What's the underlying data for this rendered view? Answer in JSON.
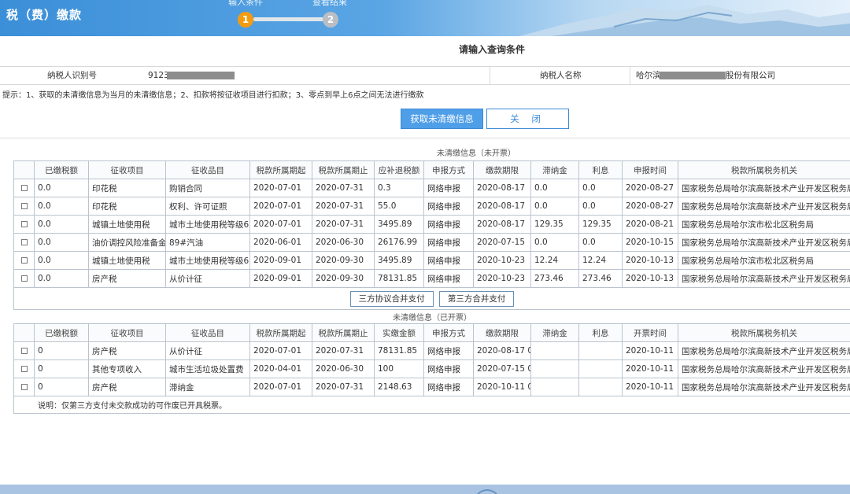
{
  "header": {
    "title": "税（费）缴款",
    "steps": [
      {
        "number": "1",
        "label": "输入条件",
        "color": "#f39c12"
      },
      {
        "number": "2",
        "label": "查看结果",
        "color": "#b9bec4"
      }
    ]
  },
  "query": {
    "title": "请输入查询条件",
    "taxpayer_id_label": "纳税人识别号",
    "taxpayer_id_value": "9123",
    "taxpayer_name_label": "纳税人名称",
    "taxpayer_name_prefix": "哈尔滨",
    "taxpayer_name_suffix": "股份有限公司"
  },
  "tip": "提示：1、获取的未清缴信息为当月的未清缴信息；2、扣款将按征收项目进行扣款；3、零点到早上6点之间无法进行缴款",
  "buttons": {
    "fetch": "获取未清缴信息",
    "close": "关 闭",
    "tripartite": "三方协议合并支付",
    "thirdparty": "第三方合并支付"
  },
  "table1": {
    "caption": "未清缴信息（未开票）",
    "headers": [
      "",
      "已缴税额",
      "征收项目",
      "征收品目",
      "税款所属期起",
      "税款所属期止",
      "应补退税额",
      "申报方式",
      "缴款期限",
      "滞纳金",
      "利息",
      "申报时间",
      "税款所属税务机关"
    ],
    "rows": [
      [
        "0.0",
        "印花税",
        "购销合同",
        "2020-07-01",
        "2020-07-31",
        "0.3",
        "网络申报",
        "2020-08-17",
        "0.0",
        "0.0",
        "2020-08-27",
        "国家税务总局哈尔滨高新技术产业开发区税务局"
      ],
      [
        "0.0",
        "印花税",
        "权利、许可证照",
        "2020-07-01",
        "2020-07-31",
        "55.0",
        "网络申报",
        "2020-08-17",
        "0.0",
        "0.0",
        "2020-08-27",
        "国家税务总局哈尔滨高新技术产业开发区税务局"
      ],
      [
        "0.0",
        "城镇土地使用税",
        "城市土地使用税等级6",
        "2020-07-01",
        "2020-07-31",
        "3495.89",
        "网络申报",
        "2020-08-17",
        "129.35",
        "129.35",
        "2020-08-21",
        "国家税务总局哈尔滨市松北区税务局"
      ],
      [
        "0.0",
        "油价调控风险准备金",
        "89#汽油",
        "2020-06-01",
        "2020-06-30",
        "26176.99",
        "网络申报",
        "2020-07-15",
        "0.0",
        "0.0",
        "2020-10-15",
        "国家税务总局哈尔滨高新技术产业开发区税务局"
      ],
      [
        "0.0",
        "城镇土地使用税",
        "城市土地使用税等级6",
        "2020-09-01",
        "2020-09-30",
        "3495.89",
        "网络申报",
        "2020-10-23",
        "12.24",
        "12.24",
        "2020-10-13",
        "国家税务总局哈尔滨市松北区税务局"
      ],
      [
        "0.0",
        "房产税",
        "从价计征",
        "2020-09-01",
        "2020-09-30",
        "78131.85",
        "网络申报",
        "2020-10-23",
        "273.46",
        "273.46",
        "2020-10-13",
        "国家税务总局哈尔滨高新技术产业开发区税务局"
      ]
    ]
  },
  "table2": {
    "caption": "未清缴信息（已开票）",
    "headers": [
      "",
      "已缴税额",
      "征收项目",
      "征收品目",
      "税款所属期起",
      "税款所属期止",
      "实缴金额",
      "申报方式",
      "缴款期限",
      "滞纳金",
      "利息",
      "开票时间",
      "税款所属税务机关"
    ],
    "rows": [
      [
        "0",
        "房产税",
        "从价计征",
        "2020-07-01",
        "2020-07-31",
        "78131.85",
        "网络申报",
        "2020-08-17 0",
        "",
        "",
        "2020-10-11",
        "国家税务总局哈尔滨高新技术产业开发区税务局"
      ],
      [
        "0",
        "其他专项收入",
        "城市生活垃圾处置费",
        "2020-04-01",
        "2020-06-30",
        "100",
        "网络申报",
        "2020-07-15 0",
        "",
        "",
        "2020-10-11",
        "国家税务总局哈尔滨高新技术产业开发区税务局"
      ],
      [
        "0",
        "房产税",
        "滞纳金",
        "2020-07-01",
        "2020-07-31",
        "2148.63",
        "网络申报",
        "2020-10-11 0",
        "",
        "",
        "2020-10-11",
        "国家税务总局哈尔滨高新技术产业开发区税务局"
      ]
    ],
    "note": "说明：仅第三方支付未交款成功的可作废已开具税票。"
  }
}
